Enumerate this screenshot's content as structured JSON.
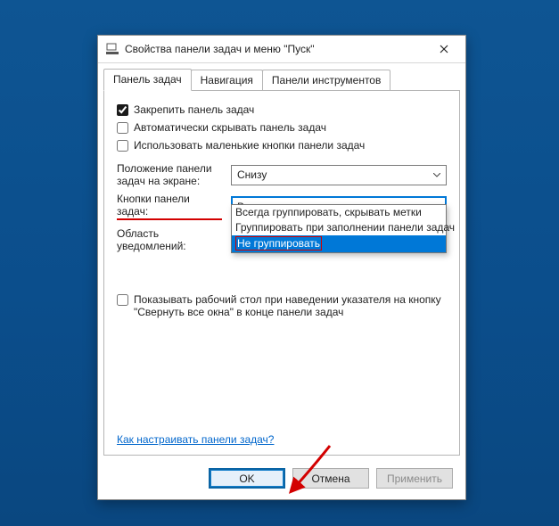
{
  "window": {
    "title": "Свойства панели задач и меню \"Пуск\""
  },
  "tabs": {
    "items": [
      {
        "label": "Панель задач",
        "active": true
      },
      {
        "label": "Навигация",
        "active": false
      },
      {
        "label": "Панели инструментов",
        "active": false
      }
    ]
  },
  "checkboxes": {
    "lock": {
      "label": "Закрепить панель задач",
      "checked": true
    },
    "autohide": {
      "label": "Автоматически скрывать панель задач",
      "checked": false
    },
    "small": {
      "label": "Использовать маленькие кнопки панели задач",
      "checked": false
    },
    "peek": {
      "label": "Показывать рабочий стол при наведении указателя на кнопку \"Свернуть все окна\" в конце панели задач",
      "checked": false
    }
  },
  "fields": {
    "position": {
      "label": "Положение панели задач на экране:",
      "value": "Снизу"
    },
    "buttons": {
      "label": "Кнопки панели задач:",
      "value": "Всегда группировать, скрывать метки",
      "options": [
        "Всегда группировать, скрывать метки",
        "Группировать при заполнении панели задач",
        "Не группировать"
      ],
      "highlighted_index": 2,
      "open": true
    },
    "notify": {
      "label": "Область уведомлений:"
    }
  },
  "link": {
    "label": "Как настраивать панели задач?"
  },
  "buttons_bar": {
    "ok": "OK",
    "cancel": "Отмена",
    "apply": "Применить"
  }
}
